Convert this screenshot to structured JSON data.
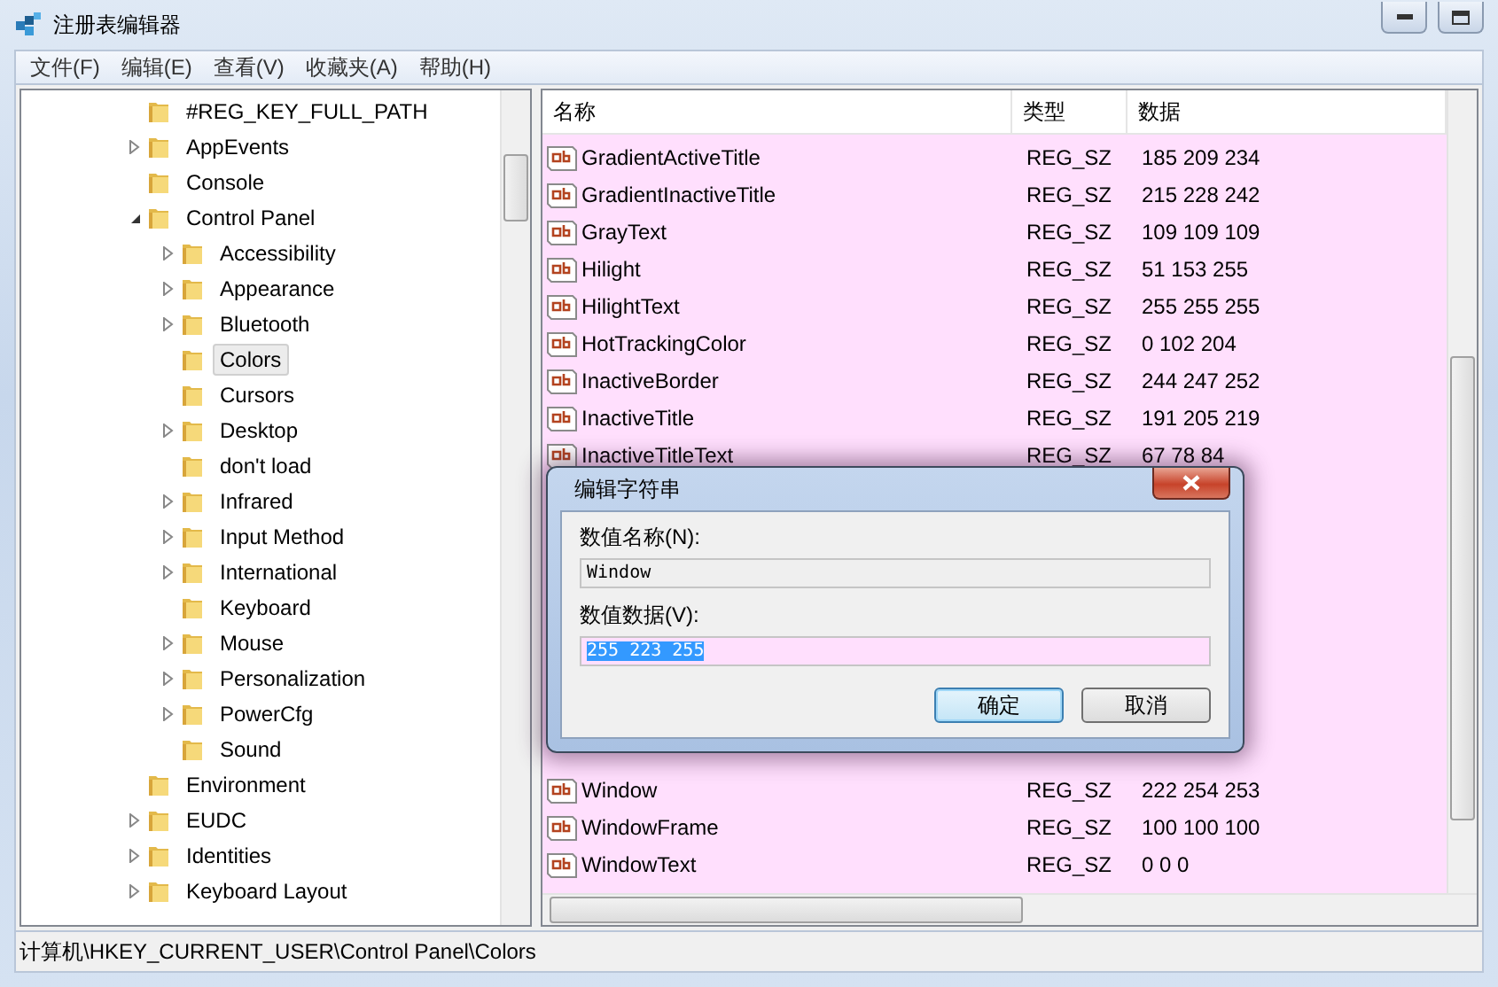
{
  "window": {
    "title": "注册表编辑器"
  },
  "menu": [
    "文件(F)",
    "编辑(E)",
    "查看(V)",
    "收藏夹(A)",
    "帮助(H)"
  ],
  "tree": [
    {
      "label": "#REG_KEY_FULL_PATH",
      "selected": false
    },
    {
      "label": "AppEvents",
      "expanded": false,
      "selected": false
    },
    {
      "label": "Console",
      "selected": false
    },
    {
      "label": "Control Panel",
      "expanded": true,
      "selected": false,
      "children": [
        {
          "label": "Accessibility",
          "expanded": false,
          "selected": false
        },
        {
          "label": "Appearance",
          "expanded": false,
          "selected": false
        },
        {
          "label": "Bluetooth",
          "expanded": false,
          "selected": false
        },
        {
          "label": "Colors",
          "selected": true
        },
        {
          "label": "Cursors",
          "selected": false
        },
        {
          "label": "Desktop",
          "expanded": false,
          "selected": false
        },
        {
          "label": "don't load",
          "selected": false
        },
        {
          "label": "Infrared",
          "expanded": false,
          "selected": false
        },
        {
          "label": "Input Method",
          "expanded": false,
          "selected": false
        },
        {
          "label": "International",
          "expanded": false,
          "selected": false
        },
        {
          "label": "Keyboard",
          "selected": false
        },
        {
          "label": "Mouse",
          "expanded": false,
          "selected": false
        },
        {
          "label": "Personalization",
          "expanded": false,
          "selected": false
        },
        {
          "label": "PowerCfg",
          "expanded": false,
          "selected": false
        },
        {
          "label": "Sound",
          "selected": false
        }
      ]
    },
    {
      "label": "Environment",
      "selected": false
    },
    {
      "label": "EUDC",
      "expanded": false,
      "selected": false
    },
    {
      "label": "Identities",
      "expanded": false,
      "selected": false
    },
    {
      "label": "Keyboard Layout",
      "expanded": false,
      "selected": false
    }
  ],
  "table": {
    "columns": [
      "名称",
      "类型",
      "数据"
    ],
    "rows_above": [
      {
        "name": "GradientActiveTitle",
        "type": "REG_SZ",
        "data": "185 209 234"
      },
      {
        "name": "GradientInactiveTitle",
        "type": "REG_SZ",
        "data": "215 228 242"
      },
      {
        "name": "GrayText",
        "type": "REG_SZ",
        "data": "109 109 109"
      },
      {
        "name": "Hilight",
        "type": "REG_SZ",
        "data": "51 153 255"
      },
      {
        "name": "HilightText",
        "type": "REG_SZ",
        "data": "255 255 255"
      },
      {
        "name": "HotTrackingColor",
        "type": "REG_SZ",
        "data": "0 102 204"
      },
      {
        "name": "InactiveBorder",
        "type": "REG_SZ",
        "data": "244 247 252"
      },
      {
        "name": "InactiveTitle",
        "type": "REG_SZ",
        "data": "191 205 219"
      },
      {
        "name": "InactiveTitleText",
        "type": "REG_SZ",
        "data": "67 78 84"
      }
    ],
    "rows_below": [
      {
        "name": "Window",
        "type": "REG_SZ",
        "data": "222 254 253"
      },
      {
        "name": "WindowFrame",
        "type": "REG_SZ",
        "data": "100 100 100"
      },
      {
        "name": "WindowText",
        "type": "REG_SZ",
        "data": "0 0 0"
      }
    ]
  },
  "dialog": {
    "title": "编辑字符串",
    "name_label": "数值名称(N):",
    "name_value": "Window",
    "data_label": "数值数据(V):",
    "data_value": "255 223 255",
    "buttons": [
      {
        "label": "确定",
        "default": true
      },
      {
        "label": "取消",
        "default": false
      }
    ]
  },
  "status_bar": "计算机\\HKEY_CURRENT_USER\\Control Panel\\Colors"
}
